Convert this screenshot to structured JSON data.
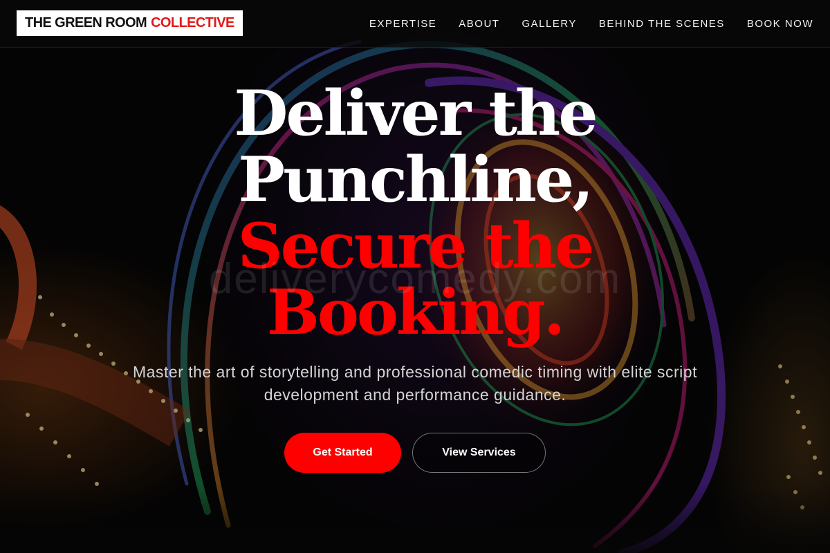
{
  "header": {
    "logo": {
      "main": "THE GREEN ROOM",
      "accent": "COLLECTIVE"
    },
    "nav": [
      {
        "label": "EXPERTISE"
      },
      {
        "label": "ABOUT"
      },
      {
        "label": "GALLERY"
      },
      {
        "label": "BEHIND THE SCENES"
      },
      {
        "label": "BOOK NOW"
      }
    ]
  },
  "hero": {
    "headline": {
      "line1": "Deliver the",
      "line2": "Punchline,",
      "line3": "Secure the",
      "line4": "Booking."
    },
    "watermark": "deliverycomedy.com",
    "subtitle": "Master the art of storytelling and professional comedic timing with elite script development and performance guidance.",
    "primary_cta": "Get Started",
    "secondary_cta": "View Services"
  },
  "colors": {
    "accent": "#ff0000",
    "logo_accent": "#e01b1b",
    "background": "#050505",
    "text": "#ffffff"
  }
}
